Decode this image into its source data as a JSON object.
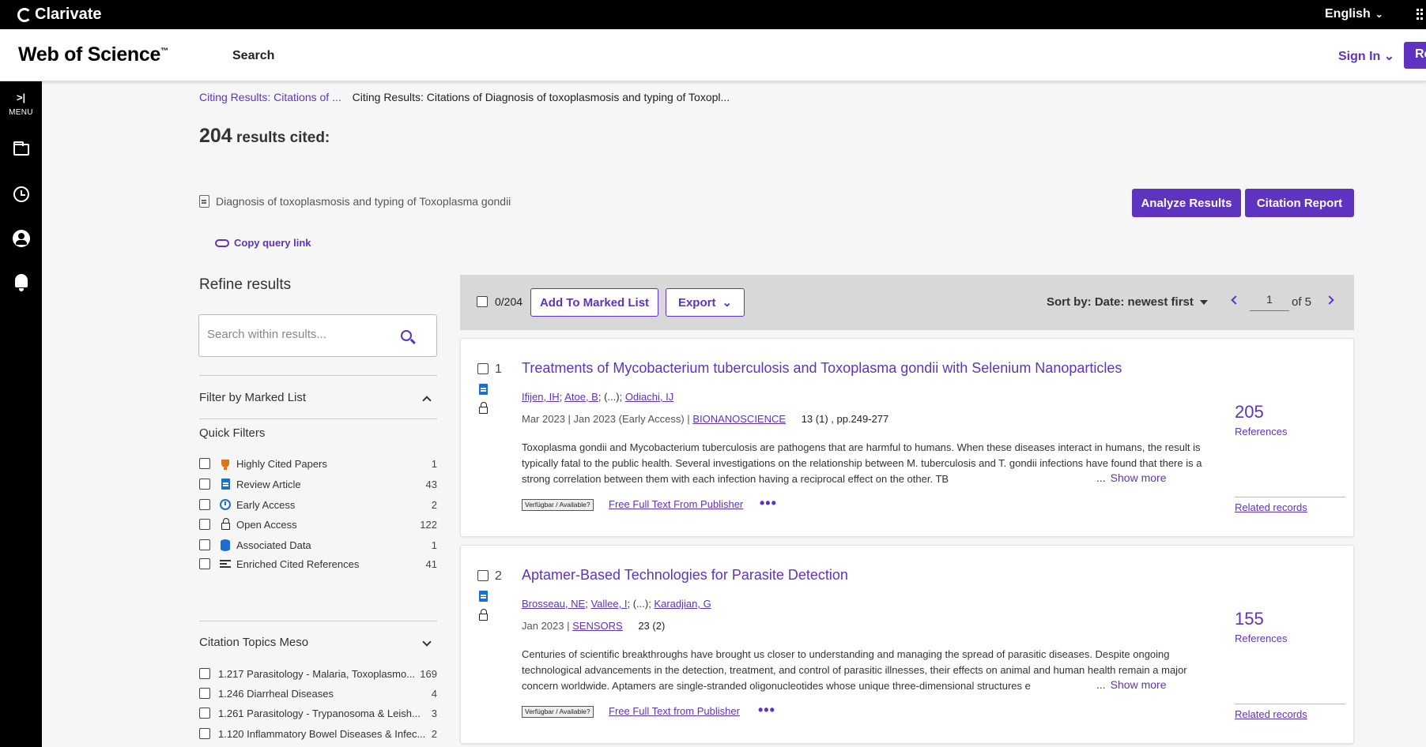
{
  "topbar": {
    "brand": "Clarivate",
    "language": "English"
  },
  "header": {
    "logo": "Web of Science",
    "logo_tm": "™",
    "nav_search": "Search",
    "sign_in": "Sign In",
    "register_partial": "Re"
  },
  "sidebar": {
    "menu_label": "MENU",
    "menu_glyph": ">|"
  },
  "breadcrumb": {
    "link": "Citing Results: Citations of ...",
    "current": "Citing Results: Citations of Diagnosis of toxoplasmosis and typing of Toxopl..."
  },
  "results": {
    "count": "204",
    "label": "results cited:"
  },
  "query": {
    "text": "Diagnosis of toxoplasmosis and typing of Toxoplasma gondii",
    "copy_link": "Copy query link"
  },
  "actions": {
    "analyze": "Analyze Results",
    "citation_report": "Citation Report"
  },
  "refine": {
    "title": "Refine results",
    "search_placeholder": "Search within results...",
    "marked_list_heading": "Filter by Marked List",
    "quick_filters_heading": "Quick Filters",
    "quick_filters": [
      {
        "label": "Highly Cited Papers",
        "count": "1",
        "icon": "trophy-icon"
      },
      {
        "label": "Review Article",
        "count": "43",
        "icon": "document-icon"
      },
      {
        "label": "Early Access",
        "count": "2",
        "icon": "clock-icon"
      },
      {
        "label": "Open Access",
        "count": "122",
        "icon": "open-lock-icon"
      },
      {
        "label": "Associated Data",
        "count": "1",
        "icon": "database-icon"
      },
      {
        "label": "Enriched Cited References",
        "count": "41",
        "icon": "enriched-list-icon"
      }
    ],
    "topics_heading": "Citation Topics Meso",
    "topics": [
      {
        "label": "1.217 Parasitology - Malaria, Toxoplasmo...",
        "count": "169"
      },
      {
        "label": "1.246 Diarrheal Diseases",
        "count": "4"
      },
      {
        "label": "1.261 Parasitology - Trypanosoma & Leish...",
        "count": "3"
      },
      {
        "label": "1.120 Inflammatory Bowel Diseases & Infec...",
        "count": "2"
      }
    ]
  },
  "toolbar": {
    "selected": "0/204",
    "add_marked": "Add To Marked List",
    "export": "Export",
    "sort": "Sort by: Date: newest first",
    "page_value": "1",
    "page_of": "of 5"
  },
  "records": [
    {
      "num": "1",
      "title": "Treatments of Mycobacterium tuberculosis and Toxoplasma gondii with Selenium Nanoparticles",
      "author1": "Ifijen, IH",
      "author2": "Atoe, B",
      "ellipsis": "(...)",
      "author3": "Odiachi, IJ",
      "date": "Mar 2023 | Jan 2023 (Early Access) |",
      "journal": "BIONANOSCIENCE",
      "volume": "13 (1) , pp.249-277",
      "abstract": "Toxoplasma gondii and Mycobacterium tuberculosis are pathogens that are harmful to humans. When these diseases interact in humans, the result is typically fatal to the public health. Several investigations on the relationship between M. tuberculosis and T. gondii infections have found that there is a strong correlation between them with each infection having a reciprocal effect on the other. TB",
      "show_more": "Show more",
      "badge": "Verfügbar / Available?",
      "fulltext": "Free Full Text From Publisher",
      "references": "205",
      "references_label": "References",
      "related": "Related records"
    },
    {
      "num": "2",
      "title": "Aptamer-Based Technologies for Parasite Detection",
      "author1": "Brosseau, NE",
      "author2": "Vallee, I",
      "ellipsis": "(...)",
      "author3": "Karadjian, G",
      "date": "Jan 2023 |",
      "journal": "SENSORS",
      "volume": "23 (2)",
      "abstract": "Centuries of scientific breakthroughs have brought us closer to understanding and managing the spread of parasitic diseases. Despite ongoing technological advancements in the detection, treatment, and control of parasitic illnesses, their effects on animal and human health remain a major concern worldwide. Aptamers are single-stranded oligonucleotides whose unique three-dimensional structures e",
      "show_more": "Show more",
      "badge": "Verfügbar / Available?",
      "fulltext": "Free Full Text from Publisher",
      "references": "155",
      "references_label": "References",
      "related": "Related records"
    }
  ],
  "ellipsis_text": "...",
  "more_actions": "•••"
}
